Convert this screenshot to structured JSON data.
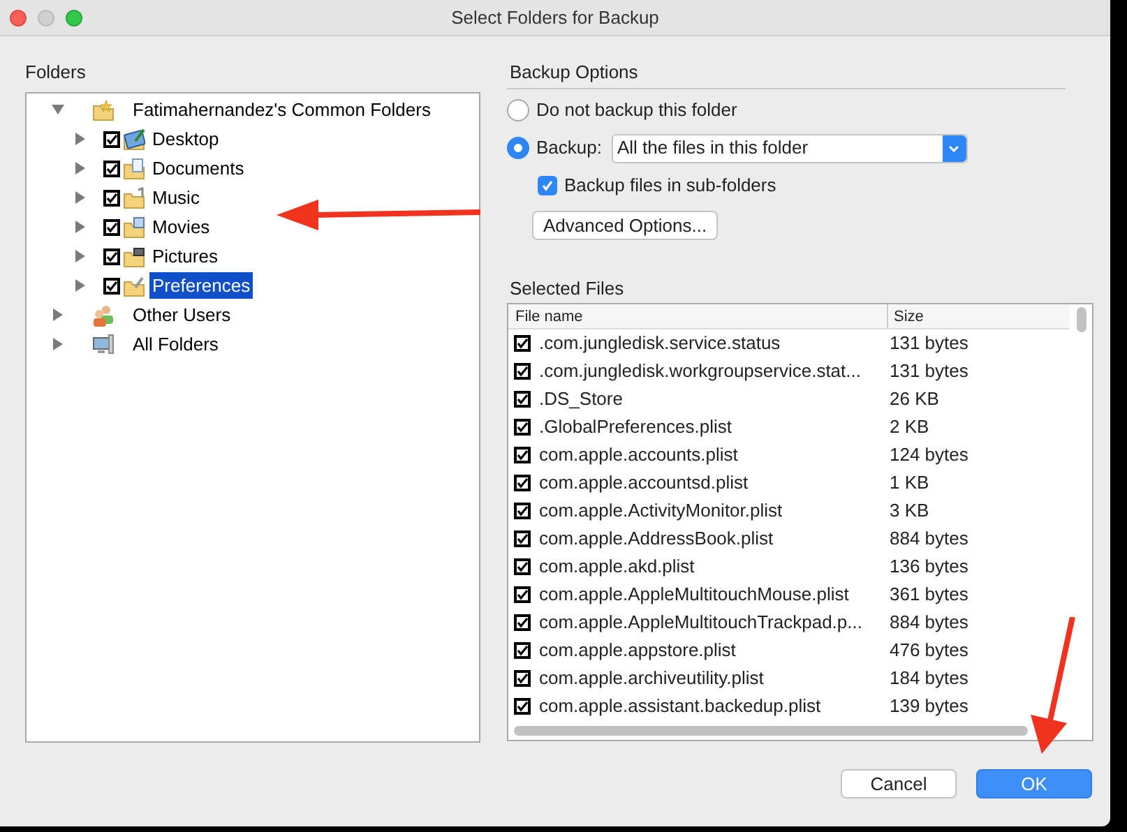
{
  "window": {
    "title": "Select Folders for Backup"
  },
  "folders": {
    "label": "Folders",
    "tree": [
      {
        "label": "Fatimahernandez's Common Folders",
        "kind": "common",
        "expanded": true,
        "selected": false,
        "children": [
          {
            "label": "Desktop",
            "kind": "desktop",
            "expanded": false,
            "checked": true,
            "selected": false
          },
          {
            "label": "Documents",
            "kind": "documents",
            "expanded": false,
            "checked": true,
            "selected": false
          },
          {
            "label": "Music",
            "kind": "music",
            "expanded": false,
            "checked": true,
            "selected": false
          },
          {
            "label": "Movies",
            "kind": "movies",
            "expanded": false,
            "checked": true,
            "selected": false
          },
          {
            "label": "Pictures",
            "kind": "pictures",
            "expanded": false,
            "checked": true,
            "selected": false
          },
          {
            "label": "Preferences",
            "kind": "preferences",
            "expanded": false,
            "checked": true,
            "selected": true
          }
        ]
      },
      {
        "label": "Other Users",
        "kind": "users",
        "expanded": false,
        "selected": false
      },
      {
        "label": "All Folders",
        "kind": "computer",
        "expanded": false,
        "selected": false
      }
    ]
  },
  "backup_options": {
    "title": "Backup Options",
    "options": [
      {
        "label": "Do not backup this folder",
        "selected": false
      },
      {
        "label": "Backup:",
        "selected": true
      }
    ],
    "backup_dropdown": {
      "value": "All the files in this folder"
    },
    "subfolders": {
      "label": "Backup files in sub-folders",
      "checked": true
    },
    "advanced_button": "Advanced Options..."
  },
  "selected_files": {
    "title": "Selected Files",
    "columns": [
      "File name",
      "Size"
    ],
    "rows": [
      {
        "checked": true,
        "name": ".com.jungledisk.service.status",
        "size": "131 bytes"
      },
      {
        "checked": true,
        "name": ".com.jungledisk.workgroupservice.stat...",
        "size": "131 bytes"
      },
      {
        "checked": true,
        "name": ".DS_Store",
        "size": "26 KB"
      },
      {
        "checked": true,
        "name": ".GlobalPreferences.plist",
        "size": "2 KB"
      },
      {
        "checked": true,
        "name": "com.apple.accounts.plist",
        "size": "124 bytes"
      },
      {
        "checked": true,
        "name": "com.apple.accountsd.plist",
        "size": "1 KB"
      },
      {
        "checked": true,
        "name": "com.apple.ActivityMonitor.plist",
        "size": "3 KB"
      },
      {
        "checked": true,
        "name": "com.apple.AddressBook.plist",
        "size": "884 bytes"
      },
      {
        "checked": true,
        "name": "com.apple.akd.plist",
        "size": "136 bytes"
      },
      {
        "checked": true,
        "name": "com.apple.AppleMultitouchMouse.plist",
        "size": "361 bytes"
      },
      {
        "checked": true,
        "name": "com.apple.AppleMultitouchTrackpad.p...",
        "size": "884 bytes"
      },
      {
        "checked": true,
        "name": "com.apple.appstore.plist",
        "size": "476 bytes"
      },
      {
        "checked": true,
        "name": "com.apple.archiveutility.plist",
        "size": "184 bytes"
      },
      {
        "checked": true,
        "name": "com.apple.assistant.backedup.plist",
        "size": "139 bytes"
      }
    ]
  },
  "buttons": [
    {
      "label": "Cancel",
      "kind": "secondary"
    },
    {
      "label": "OK",
      "kind": "primary"
    }
  ]
}
